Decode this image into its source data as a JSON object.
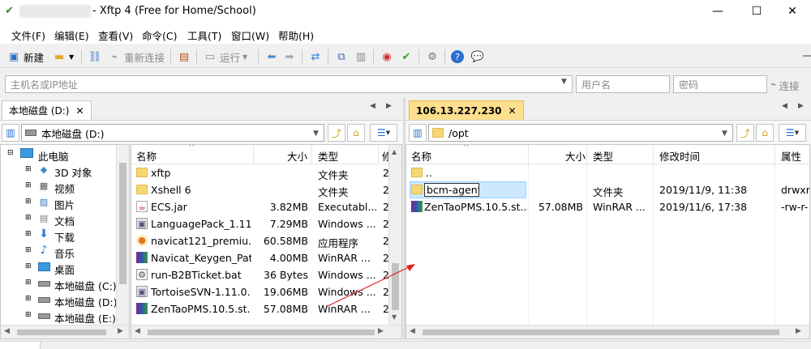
{
  "window": {
    "title": "- Xftp 4 (Free for Home/School)",
    "minimize": "—",
    "maximize": "☐",
    "close": "✕"
  },
  "menu": [
    "文件(F)",
    "编辑(E)",
    "查看(V)",
    "命令(C)",
    "工具(T)",
    "窗口(W)",
    "帮助(H)"
  ],
  "toolbar": {
    "new_label": "新建",
    "reconnect_label": "重新连接",
    "run_label": "运行"
  },
  "address": {
    "host_placeholder": "主机名或IP地址",
    "user_placeholder": "用户名",
    "password_placeholder": "密码",
    "connect_label": "连接"
  },
  "left": {
    "tab": "本地磁盘 (D:)",
    "path": "本地磁盘 (D:)",
    "tree": [
      {
        "label": "此电脑",
        "icon": "pc-icon"
      },
      {
        "label": "3D 对象",
        "icon": "3d-icon"
      },
      {
        "label": "视频",
        "icon": "video-icon"
      },
      {
        "label": "图片",
        "icon": "picture-icon"
      },
      {
        "label": "文档",
        "icon": "document-icon"
      },
      {
        "label": "下载",
        "icon": "download-icon"
      },
      {
        "label": "音乐",
        "icon": "music-icon"
      },
      {
        "label": "桌面",
        "icon": "desktop-icon"
      },
      {
        "label": "本地磁盘 (C:)",
        "icon": "drive-icon"
      },
      {
        "label": "本地磁盘 (D:)",
        "icon": "drive-icon"
      },
      {
        "label": "本地磁盘 (E:)",
        "icon": "drive-icon"
      }
    ],
    "columns": {
      "name": "名称",
      "size": "大小",
      "type": "类型"
    },
    "files": [
      {
        "name": "xftp",
        "size": "",
        "type": "文件夹",
        "col4": "2",
        "icon": "folder-icon"
      },
      {
        "name": "Xshell 6",
        "size": "",
        "type": "文件夹",
        "col4": "2",
        "icon": "folder-icon"
      },
      {
        "name": "ECS.jar",
        "size": "3.82MB",
        "type": "Executabl...",
        "col4": "2",
        "icon": "jar-icon"
      },
      {
        "name": "LanguagePack_1.11....",
        "size": "7.29MB",
        "type": "Windows ...",
        "col4": "2",
        "icon": "installer-icon"
      },
      {
        "name": "navicat121_premiu...",
        "size": "60.58MB",
        "type": "应用程序",
        "col4": "2",
        "icon": "app-icon"
      },
      {
        "name": "Navicat_Keygen_Pat...",
        "size": "4.00MB",
        "type": "WinRAR ...",
        "col4": "2",
        "icon": "rar-icon"
      },
      {
        "name": "run-B2BTicket.bat",
        "size": "36 Bytes",
        "type": "Windows ...",
        "col4": "2",
        "icon": "bat-icon"
      },
      {
        "name": "TortoiseSVN-1.11.0....",
        "size": "19.06MB",
        "type": "Windows ...",
        "col4": "2",
        "icon": "installer-icon"
      },
      {
        "name": "ZenTaoPMS.10.5.st...",
        "size": "57.08MB",
        "type": "WinRAR ...",
        "col4": "2",
        "icon": "rar-icon"
      }
    ]
  },
  "right": {
    "tab": "106.13.227.230",
    "path": "/opt",
    "columns": {
      "name": "名称",
      "size": "大小",
      "type": "类型",
      "modified": "修改时间",
      "attr": "属性"
    },
    "files": [
      {
        "name": "..",
        "size": "",
        "type": "",
        "modified": "",
        "attr": "",
        "icon": "folder-icon"
      },
      {
        "name": "bcm-agent",
        "size": "",
        "type": "文件夹",
        "modified": "2019/11/9, 11:38",
        "attr": "drwxr-",
        "icon": "folder-icon"
      },
      {
        "name": "ZenTaoPMS.10.5.st...",
        "size": "57.08MB",
        "type": "WinRAR ...",
        "modified": "2019/11/6, 17:38",
        "attr": "-rw-r-",
        "icon": "rar-icon"
      }
    ]
  },
  "colors": {
    "remote_tab": "#fddf8d",
    "selection": "#cce8ff",
    "arrow": "#e02020"
  }
}
